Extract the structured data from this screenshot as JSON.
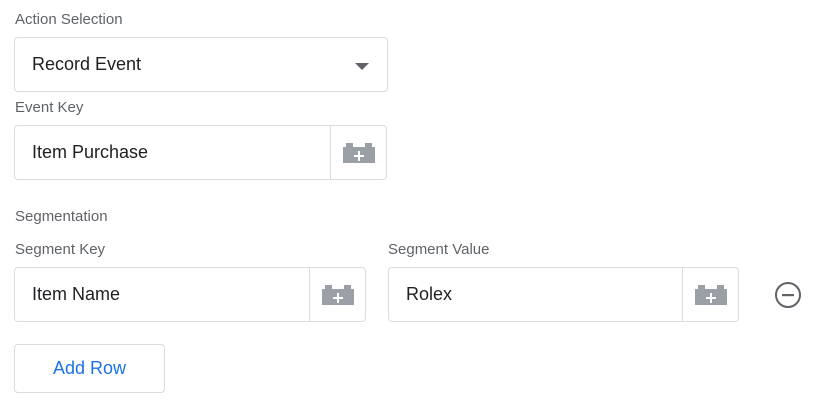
{
  "action_selection": {
    "label": "Action Selection",
    "selected": "Record Event"
  },
  "event_key": {
    "label": "Event Key",
    "value": "Item Purchase",
    "variable_icon": "lego-brick-plus-icon"
  },
  "segmentation": {
    "heading": "Segmentation",
    "key_label": "Segment Key",
    "value_label": "Segment Value",
    "rows": [
      {
        "key": "Item Name",
        "value": "Rolex"
      }
    ],
    "remove_icon": "minus-circle-icon",
    "add_row_label": "Add Row"
  },
  "colors": {
    "accent": "#1a73e8",
    "label": "#5f6368",
    "border": "#dadce0",
    "icon": "#9aa0a6"
  }
}
